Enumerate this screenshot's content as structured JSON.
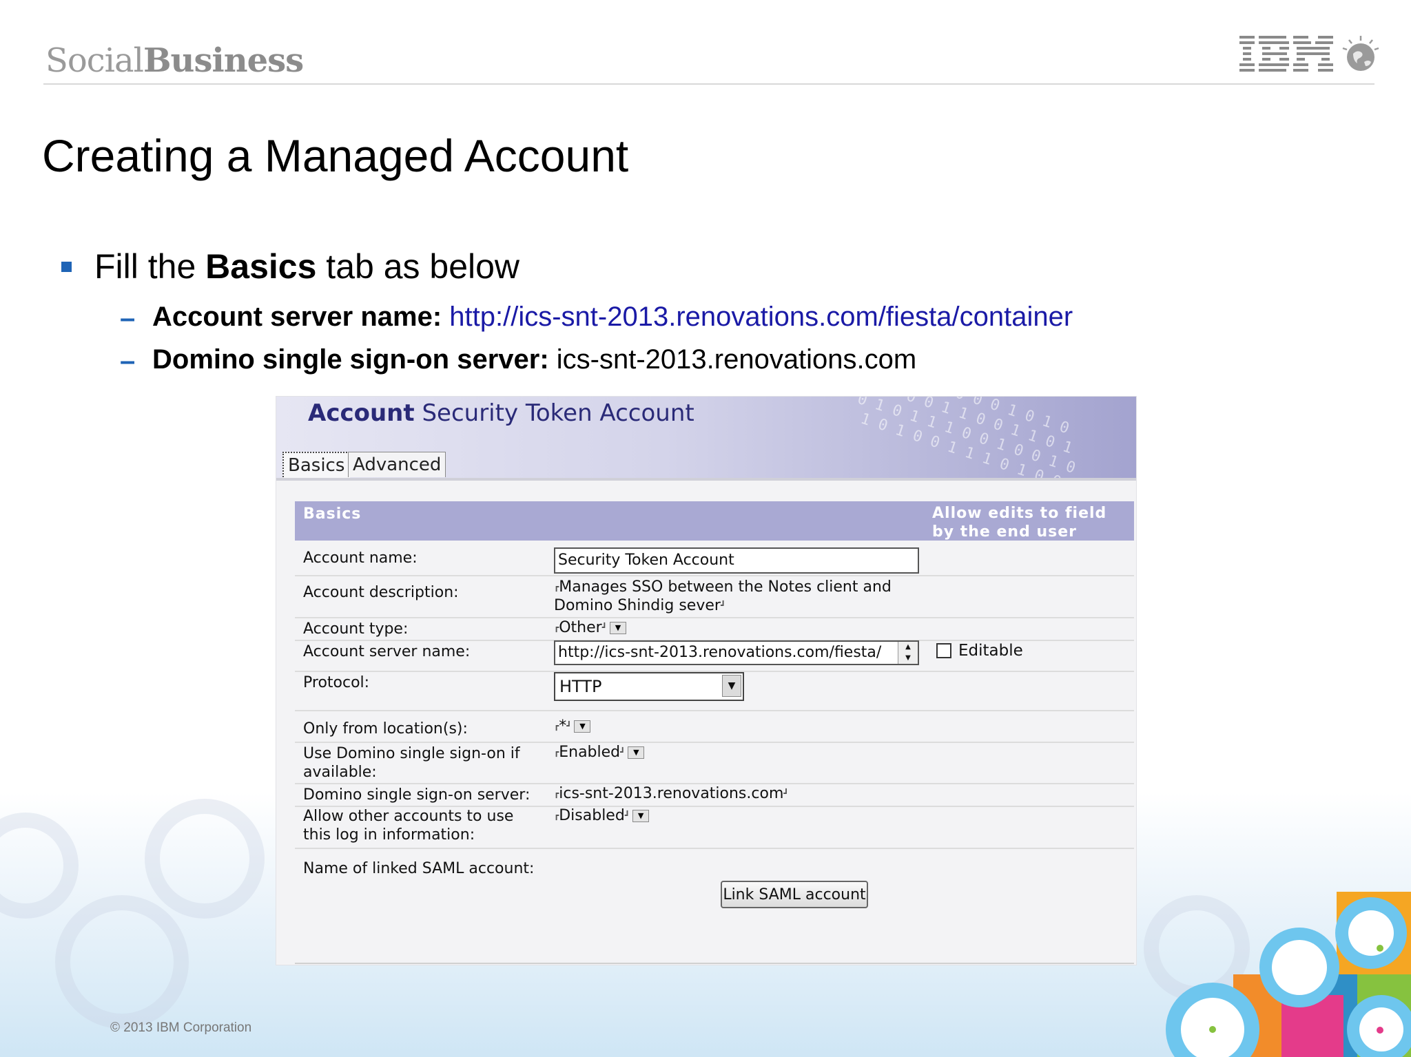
{
  "header": {
    "brand_light": "Social",
    "brand_bold": "Business",
    "ibm_logo_text": "IBM"
  },
  "slide": {
    "title": "Creating a Managed Account",
    "bullet": {
      "pre": "Fill the ",
      "bold": "Basics",
      "post": " tab as below"
    },
    "subs": [
      {
        "dash": "–",
        "label": "Account server name:",
        "value": " http://ics-snt-2013.renovations.com/fiesta/container"
      },
      {
        "dash": "–",
        "label": "Domino single sign-on server:",
        "value": " ics-snt-2013.renovations.com"
      }
    ]
  },
  "form": {
    "banner_bold": "Account",
    "banner_rest": " Security Token Account",
    "tabs": [
      "Basics",
      "Advanced"
    ],
    "section_header": "Basics",
    "allow_edits_header": "Allow edits to field by the end user",
    "rows": {
      "account_name": {
        "label": "Account name:",
        "value": "Security Token Account"
      },
      "account_description": {
        "label": "Account description:",
        "value": "Manages SSO between the Notes client and Domino Shindig sever"
      },
      "account_type": {
        "label": "Account type:",
        "value": "Other"
      },
      "server_name": {
        "label": "Account server name:",
        "value": "http://ics-snt-2013.renovations.com/fiesta/",
        "editable_label": "Editable"
      },
      "protocol": {
        "label": "Protocol:",
        "value": "HTTP"
      },
      "location": {
        "label": "Only from location(s):",
        "value": "*"
      },
      "use_sso": {
        "label": "Use Domino single sign-on if available:",
        "value": "Enabled"
      },
      "sso_server": {
        "label": "Domino single sign-on server:",
        "value": "ics-snt-2013.renovations.com"
      },
      "allow_other": {
        "label": "Allow other accounts to use this log in information:",
        "value": "Disabled"
      },
      "linked_saml": {
        "label": "Name of linked SAML account:",
        "button": "Link SAML account"
      }
    }
  },
  "footer": {
    "copyright": "© 2013 IBM Corporation"
  },
  "colors": {
    "accent": "#1f64b6",
    "banner": "#a9a9d3",
    "link": "#1a1aa6"
  }
}
